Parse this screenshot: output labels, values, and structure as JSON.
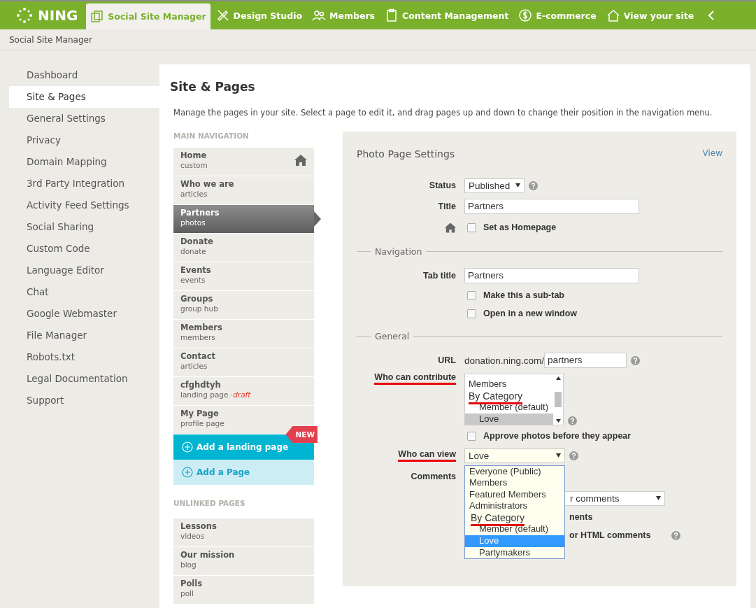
{
  "top_nav": {
    "logo": "NING",
    "tabs": [
      {
        "label": "Social Site Manager",
        "selected": true
      },
      {
        "label": "Design Studio",
        "selected": false
      },
      {
        "label": "Members",
        "selected": false
      },
      {
        "label": "Content Management",
        "selected": false
      },
      {
        "label": "E-commerce",
        "selected": false
      },
      {
        "label": "View your site",
        "selected": false
      }
    ]
  },
  "breadcrumb": "Social Site Manager",
  "sidebar": {
    "items": [
      {
        "label": "Dashboard",
        "selected": false
      },
      {
        "label": "Site & Pages",
        "selected": true
      },
      {
        "label": "General Settings",
        "selected": false
      },
      {
        "label": "Privacy",
        "selected": false
      },
      {
        "label": "Domain Mapping",
        "selected": false
      },
      {
        "label": "3rd Party Integration",
        "selected": false
      },
      {
        "label": "Activity Feed Settings",
        "selected": false
      },
      {
        "label": "Social Sharing",
        "selected": false
      },
      {
        "label": "Custom Code",
        "selected": false
      },
      {
        "label": "Language Editor",
        "selected": false
      },
      {
        "label": "Chat",
        "selected": false
      },
      {
        "label": "Google Webmaster",
        "selected": false
      },
      {
        "label": "File Manager",
        "selected": false
      },
      {
        "label": "Robots.txt",
        "selected": false
      },
      {
        "label": "Legal Documentation",
        "selected": false
      },
      {
        "label": "Support",
        "selected": false
      }
    ]
  },
  "main": {
    "title": "Site & Pages",
    "description": "Manage the pages in your site. Select a page to edit it, and drag pages up and down to change their position in the navigation menu.",
    "main_navigation": {
      "heading": "MAIN NAVIGATION",
      "pages": [
        {
          "name": "Home",
          "type": "custom",
          "homepage": true,
          "selected": false
        },
        {
          "name": "Who we are",
          "type": "articles",
          "homepage": false,
          "selected": false
        },
        {
          "name": "Partners",
          "type": "photos",
          "homepage": false,
          "selected": true
        },
        {
          "name": "Donate",
          "type": "donate",
          "homepage": false,
          "selected": false
        },
        {
          "name": "Events",
          "type": "events",
          "homepage": false,
          "selected": false
        },
        {
          "name": "Groups",
          "type": "group hub",
          "homepage": false,
          "selected": false
        },
        {
          "name": "Members",
          "type": "members",
          "homepage": false,
          "selected": false
        },
        {
          "name": "Contact",
          "type": "articles",
          "homepage": false,
          "selected": false
        },
        {
          "name": "cfghdtyh",
          "type": "landing page ·",
          "note": "draft",
          "homepage": false,
          "selected": false
        },
        {
          "name": "My Page",
          "type": "profile page",
          "homepage": false,
          "selected": false
        }
      ],
      "add_landing": {
        "label": "Add a landing page",
        "badge": "NEW"
      },
      "add_page": "Add a Page"
    },
    "unlinked": {
      "heading": "UNLINKED PAGES",
      "pages": [
        {
          "name": "Lessons",
          "type": "videos"
        },
        {
          "name": "Our mission",
          "type": "blog"
        },
        {
          "name": "Polls",
          "type": "poll"
        }
      ]
    }
  },
  "settings": {
    "title": "Photo Page Settings",
    "view_link": "View",
    "status": {
      "label": "Status",
      "value": "Published"
    },
    "title_field": {
      "label": "Title",
      "value": "Partners"
    },
    "homepage_checkbox": {
      "label": "Set as Homepage",
      "checked": false
    },
    "navigation": {
      "legend": "Navigation",
      "tab_title": {
        "label": "Tab title",
        "value": "Partners"
      },
      "checkboxes": [
        {
          "label": "Make this a sub-tab",
          "checked": false
        },
        {
          "label": "Open in a new window",
          "checked": false
        }
      ]
    },
    "general": {
      "legend": "General",
      "url": {
        "label": "URL",
        "prefix": "donation.ning.com/",
        "value": "partners"
      },
      "contribute": {
        "label": "Who can contribute",
        "underlined": true,
        "options": [
          {
            "label": "Members",
            "kind": "option",
            "selected": false,
            "underlined": false
          },
          {
            "label": "By Category",
            "kind": "group",
            "selected": false,
            "underlined": true
          },
          {
            "label": "Member (default)",
            "kind": "option",
            "selected": false,
            "underlined": false
          },
          {
            "label": "Love",
            "kind": "option",
            "selected": true,
            "underlined": false
          }
        ]
      },
      "approve_checkbox": {
        "label": "Approve photos before they appear",
        "checked": false
      },
      "view": {
        "label": "Who can view",
        "underlined": true,
        "value": "Love",
        "options": [
          {
            "label": "Everyone (Public)",
            "kind": "option",
            "selected": false,
            "underlined": false
          },
          {
            "label": "Members",
            "kind": "option",
            "selected": false,
            "underlined": false
          },
          {
            "label": "Featured Members",
            "kind": "option",
            "selected": false,
            "underlined": false
          },
          {
            "label": "Administrators",
            "kind": "option",
            "selected": false,
            "underlined": false
          },
          {
            "label": "By Category",
            "kind": "group",
            "selected": false,
            "underlined": true
          },
          {
            "label": "Member (default)",
            "kind": "sub",
            "selected": false,
            "underlined": false
          },
          {
            "label": "Love",
            "kind": "sub",
            "selected": true,
            "underlined": false
          },
          {
            "label": "Partymakers",
            "kind": "sub",
            "selected": false,
            "underlined": false
          }
        ]
      },
      "comments": {
        "label": "Comments",
        "select_value": "r comments",
        "text_1": "nents",
        "text_2": "or HTML comments"
      }
    }
  }
}
